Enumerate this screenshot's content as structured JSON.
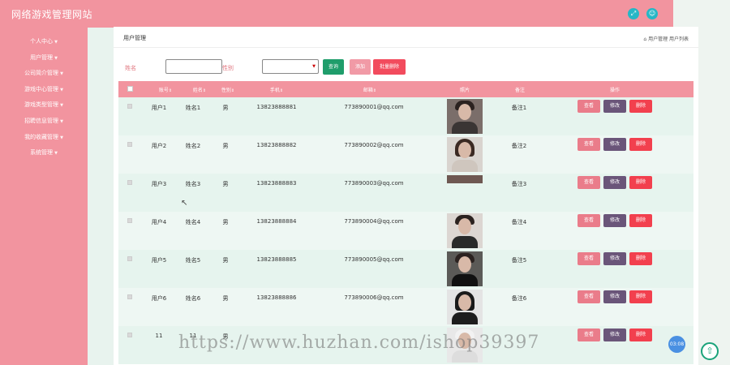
{
  "app": {
    "title": "网络游戏管理网站"
  },
  "top_icons": [
    "fullscreen-icon",
    "user-icon"
  ],
  "sidebar": {
    "items": [
      {
        "label": "个人中心"
      },
      {
        "label": "用户管理"
      },
      {
        "label": "公司简介管理"
      },
      {
        "label": "游戏中心管理"
      },
      {
        "label": "游戏类型管理"
      },
      {
        "label": "招聘信息管理"
      },
      {
        "label": "我的收藏管理"
      },
      {
        "label": "系统管理"
      }
    ]
  },
  "page": {
    "title": "用户管理",
    "breadcrumb": "用户管理 用户列表"
  },
  "filters": {
    "name_label": "姓名",
    "name_value": "",
    "gender_label": "性别",
    "gender_selected": "",
    "search_label": "查询",
    "add_label": "添加",
    "batch_delete_label": "批量删除"
  },
  "table": {
    "headers": [
      "账号",
      "姓名",
      "性别",
      "手机",
      "邮箱",
      "照片",
      "备注",
      "操作"
    ],
    "sort_marker": "⇕",
    "actions": {
      "view": "查看",
      "edit": "修改",
      "delete": "删除"
    },
    "rows": [
      {
        "account": "用户1",
        "name": "姓名1",
        "gender": "男",
        "phone": "13823888881",
        "email": "773890001@qq.com",
        "note": "备注1"
      },
      {
        "account": "用户2",
        "name": "姓名2",
        "gender": "男",
        "phone": "13823888882",
        "email": "773890002@qq.com",
        "note": "备注2"
      },
      {
        "account": "用户3",
        "name": "姓名3",
        "gender": "男",
        "phone": "13823888883",
        "email": "773890003@qq.com",
        "note": "备注3"
      },
      {
        "account": "用户4",
        "name": "姓名4",
        "gender": "男",
        "phone": "13823888884",
        "email": "773890004@qq.com",
        "note": "备注4"
      },
      {
        "account": "用户5",
        "name": "姓名5",
        "gender": "男",
        "phone": "13823888885",
        "email": "773890005@qq.com",
        "note": "备注5"
      },
      {
        "account": "用户6",
        "name": "姓名6",
        "gender": "男",
        "phone": "13823888886",
        "email": "773890006@qq.com",
        "note": "备注6"
      },
      {
        "account": "11",
        "name": "11",
        "gender": "男",
        "phone": "",
        "email": "",
        "note": ""
      }
    ]
  },
  "watermark": "https://www.huzhan.com/ishop39397",
  "timer": "03:08",
  "colors": {
    "primary": "#f2949f",
    "search": "#1f9d6b",
    "delete": "#f2404e",
    "edit": "#6a5579"
  }
}
